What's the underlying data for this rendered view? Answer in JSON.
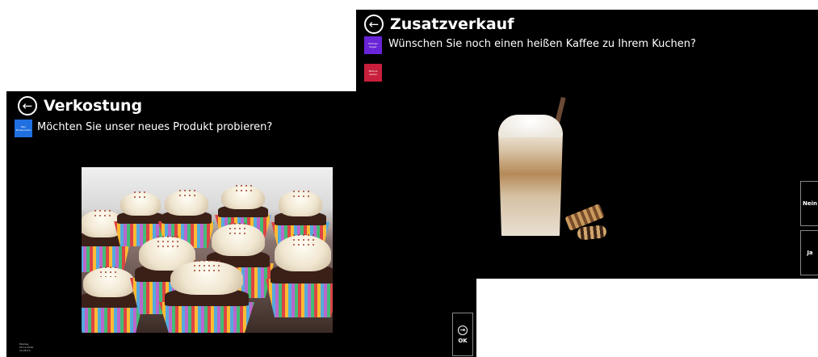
{
  "tasting": {
    "title": "Verkostung",
    "question": "Möchten Sie unser neues Produkt probieren?",
    "tile": {
      "label": "Max Mustermann",
      "color": "#1f6fe0"
    },
    "ok_label": "OK",
    "footer": {
      "day": "Montag",
      "date": "05.12.2016",
      "time": "15:28:13"
    }
  },
  "upsell": {
    "title": "Zusatzverkauf",
    "question": "Wünschen Sie noch einen heißen Kaffee zu Ihrem Kuchen?",
    "tiles": [
      {
        "label": "Michael Kugler",
        "color": "#6a24d8"
      },
      {
        "label": "Markus Seidel",
        "color": "#c8203c"
      }
    ],
    "no_label": "Nein",
    "yes_label": "Ja"
  },
  "icons": {
    "back": "back-arrow-icon",
    "ok": "arrow-right-circle-icon"
  }
}
